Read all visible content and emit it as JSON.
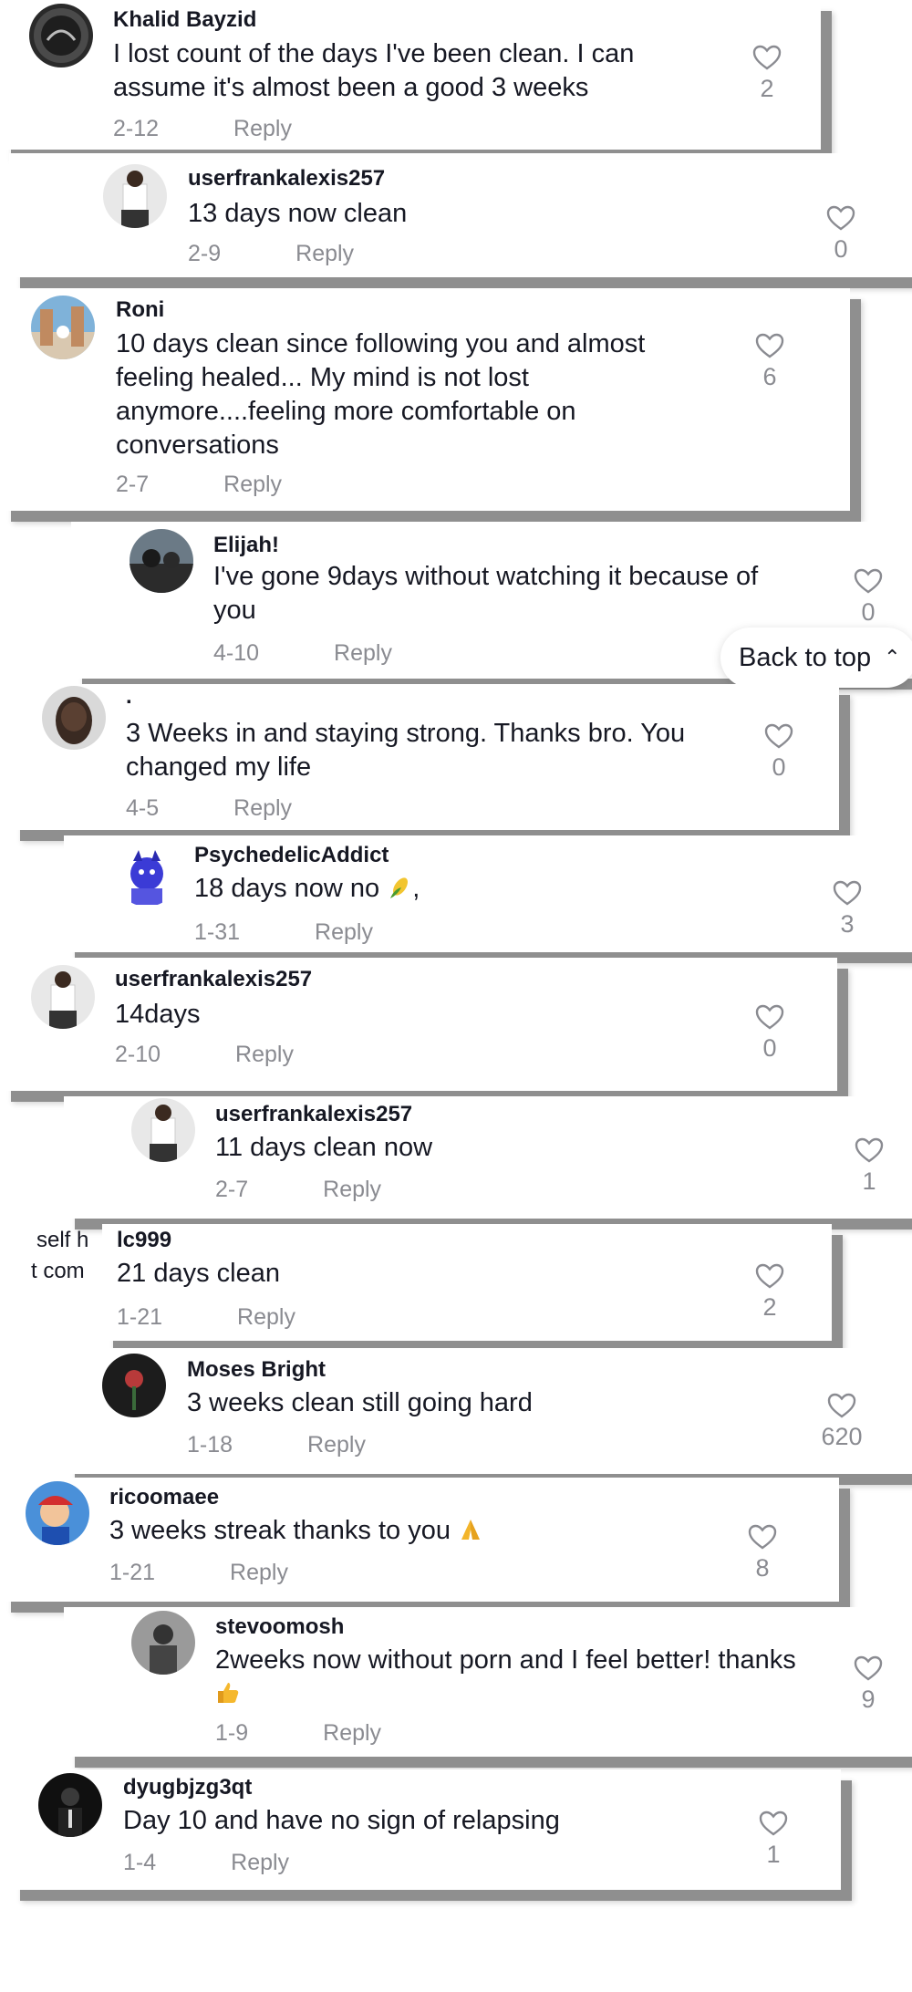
{
  "colors": {
    "text": "#161823",
    "meta": "#8a8b91",
    "shadow": "#8f8f8f"
  },
  "reply_label": "Reply",
  "back_to_top": {
    "label": "Back to top",
    "icon": "double-chevron-up-icon"
  },
  "overlap_fragments": [
    "self h",
    "t com"
  ],
  "comments": [
    {
      "username": "Khalid Bayzid",
      "text": "I lost count of the days I've been clean. I can assume it's almost been a good 3 weeks",
      "date": "2-12",
      "likes": "2"
    },
    {
      "username": "userfrankalexis257",
      "text": "13 days now clean",
      "date": "2-9",
      "likes": "0"
    },
    {
      "username": "Roni",
      "text": "10 days clean since following you and almost feeling healed... My mind is not lost anymore....feeling more comfortable on conversations",
      "date": "2-7",
      "likes": "6"
    },
    {
      "username": "Elijah!",
      "text": "I've gone 9days without watching it because of you",
      "date": "4-10",
      "likes": "0"
    },
    {
      "username": ".",
      "text": "3 Weeks in and staying strong. Thanks bro. You changed my life",
      "date": "4-5",
      "likes": "0"
    },
    {
      "username": "PsychedelicAddict",
      "text": "18 days now no",
      "text_suffix": ",",
      "emoji": "corn",
      "date": "1-31",
      "likes": "3"
    },
    {
      "username": "userfrankalexis257",
      "text": "14days",
      "date": "2-10",
      "likes": "0"
    },
    {
      "username": "userfrankalexis257",
      "text": "11 days clean now",
      "date": "2-7",
      "likes": "1"
    },
    {
      "username": "lc999",
      "text": "21 days clean",
      "date": "1-21",
      "likes": "2"
    },
    {
      "username": "Moses Bright",
      "text": "3 weeks clean still going hard",
      "date": "1-18",
      "likes": "620"
    },
    {
      "username": "ricoomaee",
      "text": "3 weeks streak thanks to you",
      "emoji": "folded-hands",
      "date": "1-21",
      "likes": "8"
    },
    {
      "username": "stevoomosh",
      "text": "2weeks now without porn and I feel better! thanks",
      "emoji": "thumbs-up",
      "date": "1-9",
      "likes": "9"
    },
    {
      "username": "dyugbjzg3qt",
      "text": "Day 10 and have no sign of relapsing",
      "date": "1-4",
      "likes": "1"
    }
  ]
}
